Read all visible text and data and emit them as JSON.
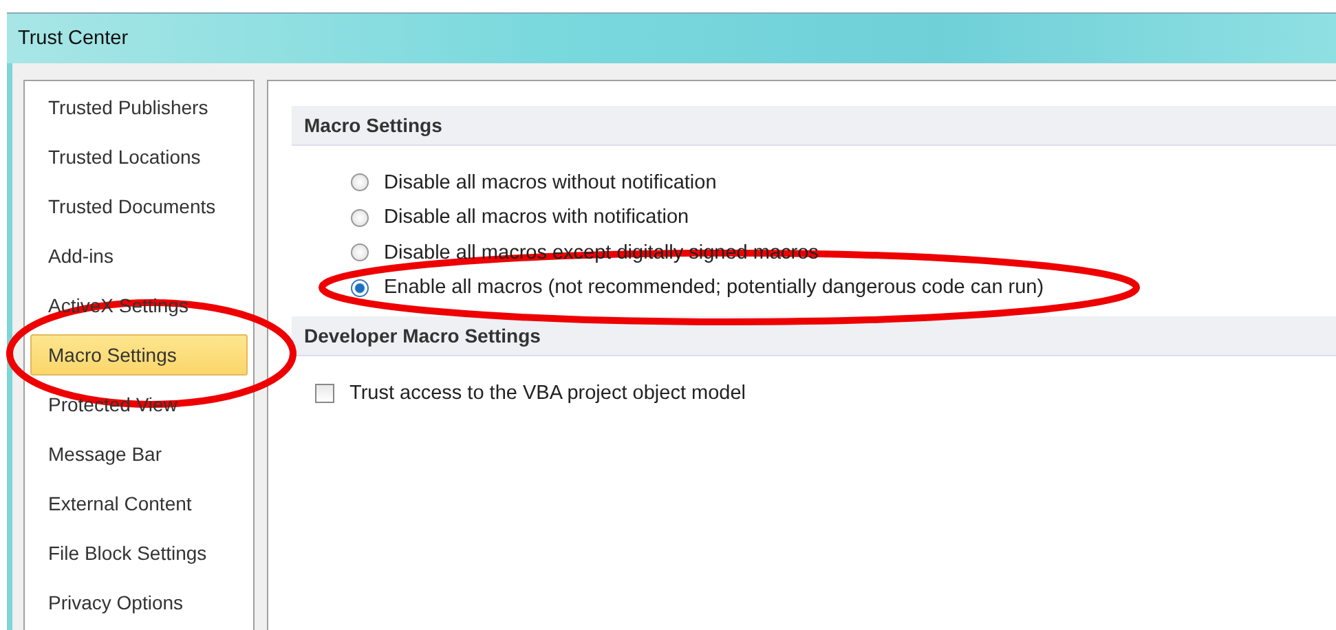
{
  "window": {
    "title": "Trust Center"
  },
  "sidebar": {
    "items": [
      {
        "label": "Trusted Publishers",
        "selected": false
      },
      {
        "label": "Trusted Locations",
        "selected": false
      },
      {
        "label": "Trusted Documents",
        "selected": false
      },
      {
        "label": "Add-ins",
        "selected": false
      },
      {
        "label": "ActiveX Settings",
        "selected": false
      },
      {
        "label": "Macro Settings",
        "selected": true
      },
      {
        "label": "Protected View",
        "selected": false
      },
      {
        "label": "Message Bar",
        "selected": false
      },
      {
        "label": "External Content",
        "selected": false
      },
      {
        "label": "File Block Settings",
        "selected": false
      },
      {
        "label": "Privacy Options",
        "selected": false
      }
    ]
  },
  "sections": [
    {
      "title": "Macro Settings",
      "options": [
        {
          "kind": "radio",
          "label": "Disable all macros without notification",
          "selected": false
        },
        {
          "kind": "radio",
          "label": "Disable all macros with notification",
          "selected": false
        },
        {
          "kind": "radio",
          "label": "Disable all macros except digitally signed macros",
          "selected": false
        },
        {
          "kind": "radio",
          "label": "Enable all macros (not recommended; potentially dangerous code can run)",
          "selected": true
        }
      ]
    },
    {
      "title": "Developer Macro Settings",
      "options": [
        {
          "kind": "checkbox",
          "label": "Trust access to the VBA project object model",
          "checked": false
        }
      ]
    }
  ]
}
